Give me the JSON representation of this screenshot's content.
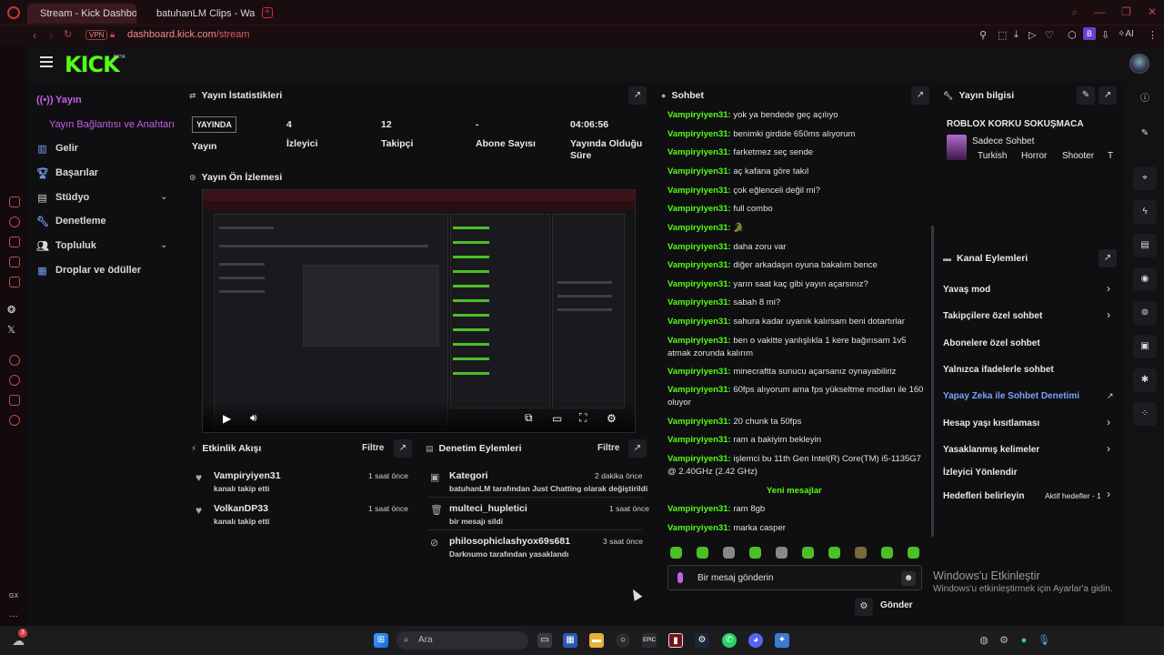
{
  "browser": {
    "tabs": [
      {
        "title": "Stream - Kick Dashboard"
      },
      {
        "title": "batuhanLM Clips - Watch"
      }
    ],
    "vpn_label": "VPN",
    "url_host": "dashboard.kick.com",
    "url_path": "/stream",
    "profile_letter": "B",
    "ai_label": "AI",
    "sidebar_label": "GX"
  },
  "kick": {
    "logo": "KICK",
    "beta": "BETA"
  },
  "nav": {
    "items": [
      {
        "label": "Yayın"
      },
      {
        "label": "Yayın Bağlantısı ve Anahtarı"
      },
      {
        "label": "Gelir"
      },
      {
        "label": "Başarılar"
      },
      {
        "label": "Stüdyo"
      },
      {
        "label": "Denetleme"
      },
      {
        "label": "Topluluk"
      },
      {
        "label": "Droplar ve ödüller"
      }
    ]
  },
  "stats": {
    "title": "Yayın İstatistikleri",
    "live_badge": "YAYINDA",
    "live_label": "Yayın",
    "items": [
      {
        "value": "4",
        "label": "İzleyici"
      },
      {
        "value": "12",
        "label": "Takipçi"
      },
      {
        "value": "-",
        "label": "Abone Sayısı"
      },
      {
        "value": "04:06:56",
        "label": "Yayında Olduğu Süre"
      }
    ]
  },
  "preview": {
    "title": "Yayın Ön İzlemesi"
  },
  "activity": {
    "title": "Etkinlik Akışı",
    "filter": "Filtre",
    "items": [
      {
        "name": "Vampiryiyen31",
        "action": "kanalı takip etti",
        "time": "1 saat önce"
      },
      {
        "name": "VolkanDP33",
        "action": "kanalı takip etti",
        "time": "1 saat önce"
      }
    ]
  },
  "moderation": {
    "title": "Denetim Eylemleri",
    "filter": "Filtre",
    "items": [
      {
        "name": "Kategori",
        "detail": "batuhanLM tarafından Just Chatting olarak değiştirildi",
        "time": "2 dakika önce"
      },
      {
        "name": "multeci_hupletici",
        "detail": "bir mesajı sildi",
        "time": "1 saat önce"
      },
      {
        "name": "philosophiclashyox69s681",
        "detail": "Darknumo tarafından yasaklandı",
        "time": "3 saat önce"
      }
    ]
  },
  "chat": {
    "title": "Sohbet",
    "messages": [
      {
        "user": "Vampiryiyen31:",
        "text": "yok ya bendede geç açılıyo"
      },
      {
        "user": "Vampiryiyen31:",
        "text": "benimki girdide 650ms alıyorum"
      },
      {
        "user": "Vampiryiyen31:",
        "text": "farketmez seç sende"
      },
      {
        "user": "Vampiryiyen31:",
        "text": "aç kafana göre takıl"
      },
      {
        "user": "Vampiryiyen31:",
        "text": "çok eğlenceli değil mi?"
      },
      {
        "user": "Vampiryiyen31:",
        "text": "full combo"
      },
      {
        "user": "Vampiryiyen31:",
        "text": "🐊"
      },
      {
        "user": "Vampiryiyen31:",
        "text": "daha zoru var"
      },
      {
        "user": "Vampiryiyen31:",
        "text": "diğer arkadaşın oyuna bakalım bence"
      },
      {
        "user": "Vampiryiyen31:",
        "text": "yarın saat kaç gibi yayın açarsınız?"
      },
      {
        "user": "Vampiryiyen31:",
        "text": "sabah 8 mi?"
      },
      {
        "user": "Vampiryiyen31:",
        "text": "sahura kadar uyanık kalırsam beni dotartırlar"
      },
      {
        "user": "Vampiryiyen31:",
        "text": "ben o vakitte yanlışlıkla 1 kere bağırısam 1v5 atmak zorunda kalırım"
      },
      {
        "user": "Vampiryiyen31:",
        "text": "minecraftta sunucu açarsanız oynayabiliriz"
      },
      {
        "user": "Vampiryiyen31:",
        "text": "60fps alıyorum ama fps yükseltme modları ile 160 oluyor"
      },
      {
        "user": "Vampiryiyen31:",
        "text": "20 chunk ta 50fps"
      },
      {
        "user": "Vampiryiyen31:",
        "text": "ram a bakiyim bekleyin"
      },
      {
        "user": "Vampiryiyen31:",
        "text": "işlemci bu 11th Gen Intel(R) Core(TM) i5-1135G7 @ 2.40GHz (2.42 GHz)"
      }
    ],
    "new_messages_label": "Yeni mesajlar",
    "new_messages": [
      {
        "user": "Vampiryiyen31:",
        "text": "ram 8gb"
      },
      {
        "user": "Vampiryiyen31:",
        "text": "marka casper"
      }
    ],
    "input_placeholder": "Bir mesaj gönderin",
    "send_label": "Gönder"
  },
  "stream_info": {
    "title": "Yayın bilgisi",
    "stream_title": "ROBLOX KORKU SOKUŞMACA",
    "category": "Sadece Sohbet",
    "tags": [
      "Turkish",
      "Horror",
      "Shooter",
      "T"
    ]
  },
  "channel_actions": {
    "title": "Kanal Eylemleri",
    "items": [
      {
        "label": "Yavaş mod"
      },
      {
        "label": "Takipçilere özel sohbet"
      },
      {
        "label": "Abonelere özel sohbet"
      },
      {
        "label": "Yalnızca ifadelerle sohbet"
      },
      {
        "label": "Yapay Zeka ile Sohbet Denetimi"
      },
      {
        "label": "Hesap yaşı kısıtlaması"
      },
      {
        "label": "Yasaklanmış kelimeler"
      },
      {
        "label": "İzleyici Yönlendir"
      },
      {
        "label": "Hedefleri belirleyin"
      }
    ],
    "goals_status": "Aktif hedefler - 1"
  },
  "windows": {
    "activation_title": "Windows'u Etkinleştir",
    "activation_text": "Windows'u etkinleştirmek için Ayarlar'a gidin.",
    "search_placeholder": "Ara",
    "notification_badge": "3"
  },
  "colors": {
    "kick_green": "#53fc18",
    "accent_purple": "#c55ee8",
    "link_blue": "#7aa2f7"
  }
}
